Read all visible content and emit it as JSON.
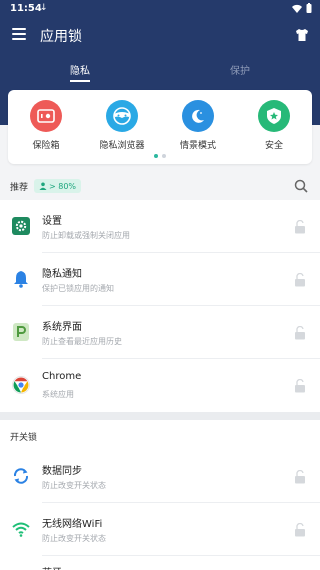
{
  "status_bar": {
    "time": "11:54",
    "download_indicator": "↓"
  },
  "app_bar": {
    "title": "应用锁"
  },
  "tabs": [
    {
      "label": "隐私"
    },
    {
      "label": "保护"
    }
  ],
  "quick_actions": [
    {
      "label": "保险箱",
      "icon": "safe-box-icon",
      "color": "#ee5a57"
    },
    {
      "label": "隐私浏览器",
      "icon": "private-browser-icon",
      "color": "#2aa9e5"
    },
    {
      "label": "情景模式",
      "icon": "moon-icon",
      "color": "#2a90e0"
    },
    {
      "label": "安全",
      "icon": "shield-star-icon",
      "color": "#27b978"
    }
  ],
  "recommend": {
    "label": "推荐",
    "badge": "> 80%"
  },
  "apps": [
    {
      "title": "设置",
      "subtitle": "防止卸载或强制关闭应用",
      "icon": "settings-icon"
    },
    {
      "title": "隐私通知",
      "subtitle": "保护已锁应用的通知",
      "icon": "bell-icon"
    },
    {
      "title": "系统界面",
      "subtitle": "防止查看最近应用历史",
      "icon": "system-ui-icon"
    },
    {
      "title": "Chrome",
      "subtitle": "系统应用",
      "icon": "chrome-icon"
    }
  ],
  "switch_lock": {
    "label": "开关锁",
    "items": [
      {
        "title": "数据同步",
        "subtitle": "防止改变开关状态",
        "icon": "sync-icon"
      },
      {
        "title": "无线网络WiFi",
        "subtitle": "防止改变开关状态",
        "icon": "wifi-icon"
      }
    ],
    "partial_title": "蓝牙"
  }
}
